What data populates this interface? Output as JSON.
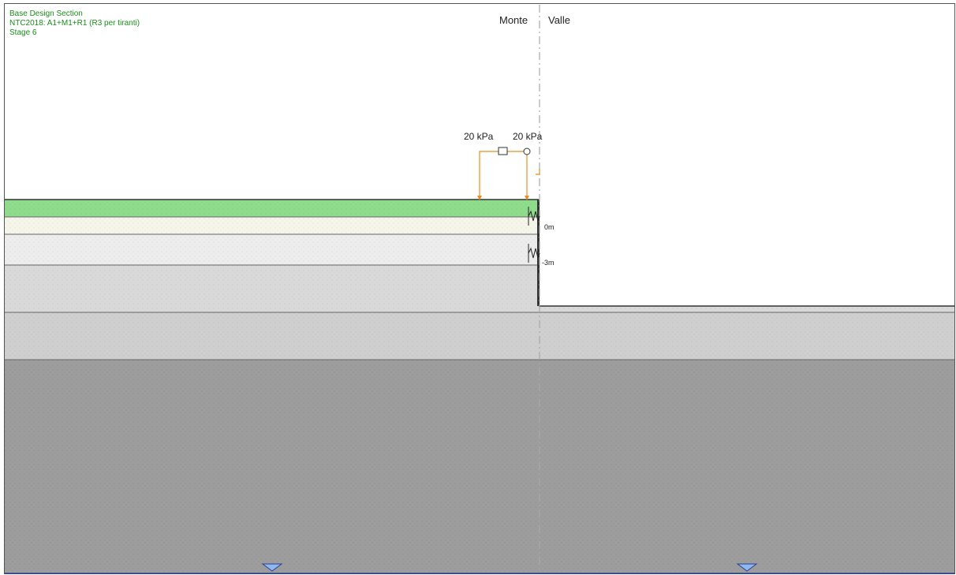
{
  "header": {
    "line1": "Base Design Section",
    "line2": "NTC2018: A1+M1+R1 (R3 per tiranti)",
    "line3": "Stage 6"
  },
  "sides": {
    "left": "Monte",
    "right": "Valle"
  },
  "loads": [
    {
      "label": "20 kPa"
    },
    {
      "label": "20 kPa"
    }
  ],
  "depth_labels": [
    "0m",
    "-3m"
  ],
  "colors": {
    "layer_topsoil": "#8fdc8c",
    "layer_sand": "#f6f5ea",
    "layer_light_gray": "#ededed",
    "layer_gray": "#d9d9d9",
    "layer_mid_gray": "#cfcfcf",
    "layer_dark_gray": "#9d9d9d",
    "load_color": "#f08a24",
    "header_text": "#1a8f1a",
    "water_marker": "#8fb8f0"
  },
  "icons": [
    "water-table-icon",
    "water-table-icon"
  ]
}
